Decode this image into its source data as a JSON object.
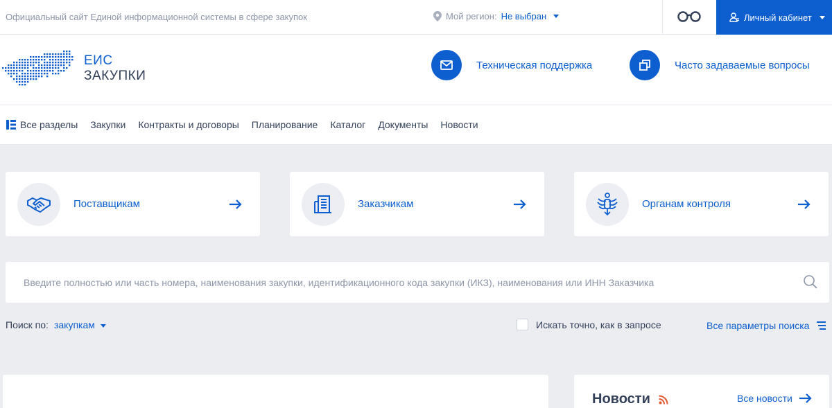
{
  "topbar": {
    "site_title": "Официальный сайт Единой информационной системы в сфере закупок",
    "region_label": "Мой регион:",
    "region_value": "Не выбран",
    "cabinet_label": "Личный кабинет"
  },
  "header": {
    "logo_line1": "ЕИС",
    "logo_line2": "ЗАКУПКИ",
    "support_label": "Техническая поддержка",
    "faq_label": "Часто задаваемые вопросы"
  },
  "nav": {
    "items": [
      "Все разделы",
      "Закупки",
      "Контракты и договоры",
      "Планирование",
      "Каталог",
      "Документы",
      "Новости"
    ]
  },
  "cards": [
    {
      "label": "Поставщикам",
      "icon": "handshake-icon"
    },
    {
      "label": "Заказчикам",
      "icon": "building-icon"
    },
    {
      "label": "Органам контроля",
      "icon": "emblem-icon"
    }
  ],
  "search": {
    "placeholder": "Введите полностью или часть номера, наименования закупки, идентификационного кода закупки (ИКЗ), наименования или ИНН Заказчика",
    "value": ""
  },
  "search_options": {
    "search_by_label": "Поиск по:",
    "search_by_value": "закупкам",
    "exact_label": "Искать точно, как в запросе",
    "exact_checked": false,
    "all_params_label": "Все параметры поиска"
  },
  "news": {
    "title": "Новости",
    "all_news_label": "Все новости"
  },
  "colors": {
    "accent": "#0d5fcf",
    "background": "#ecedf1",
    "text": "#334059",
    "muted": "#8d96a8",
    "rss": "#e4572e"
  }
}
